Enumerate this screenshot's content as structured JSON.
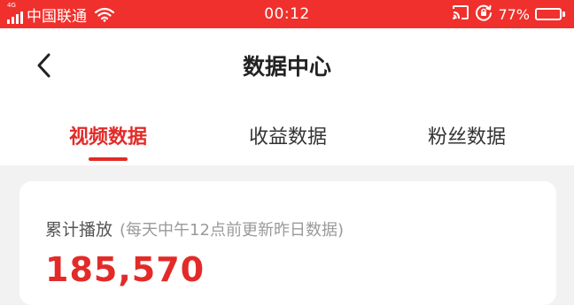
{
  "status_bar": {
    "network_label": "4G",
    "carrier": "中国联通",
    "time": "00:12",
    "battery_percent": "77%",
    "battery_level": 0.77,
    "color": "#f0302c"
  },
  "header": {
    "back_icon": "chevron-left-icon",
    "title": "数据中心"
  },
  "tabs": [
    {
      "label": "视频数据",
      "active": true
    },
    {
      "label": "收益数据",
      "active": false
    },
    {
      "label": "粉丝数据",
      "active": false
    }
  ],
  "accent_color": "#e22b28",
  "card": {
    "label": "累计播放",
    "note": "(每天中午12点前更新昨日数据)",
    "value": "185,570"
  }
}
